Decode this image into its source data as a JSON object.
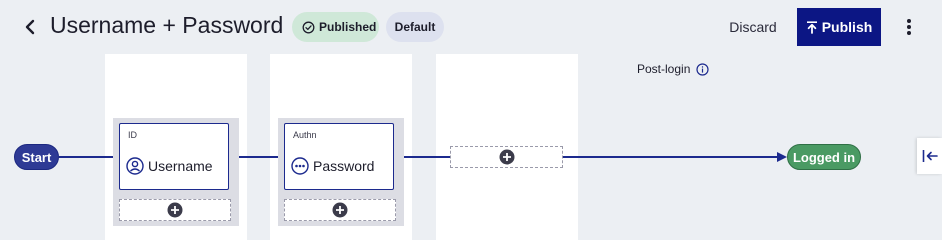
{
  "header": {
    "title": "Username + Password",
    "status_badge": "Published",
    "default_badge": "Default",
    "discard_label": "Discard",
    "publish_label": "Publish"
  },
  "canvas": {
    "post_login_label": "Post-login",
    "start_label": "Start",
    "end_label": "Logged in",
    "steps": [
      {
        "kind": "ID",
        "label": "Username",
        "icon": "user-icon"
      },
      {
        "kind": "Authn",
        "label": "Password",
        "icon": "password-icon"
      }
    ]
  },
  "colors": {
    "primary": "#0c1684",
    "flow_line": "#1c2a8e",
    "start": "#2e3a95",
    "success": "#4a9a63",
    "published_badge_bg": "#cfe8d8",
    "default_badge_bg": "#dde1ef"
  }
}
